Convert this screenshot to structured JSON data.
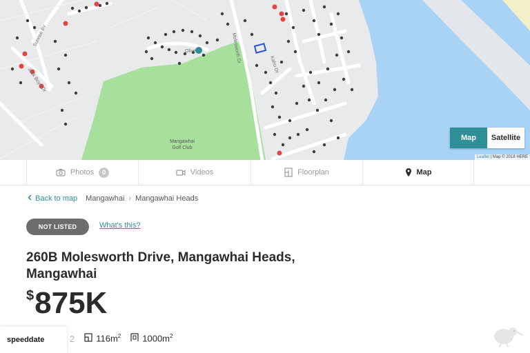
{
  "map": {
    "toggle": {
      "map_label": "Map",
      "satellite_label": "Satellite",
      "selected": "Map"
    },
    "labels": {
      "golf_line1": "Mangawhai",
      "golf_line2": "Golf Club"
    },
    "attribution": {
      "leaflet": "Leaflet",
      "rest": " | Map © 2018 HERE"
    },
    "colors": {
      "water": "#a9d3f5",
      "park": "#a7df9c",
      "land": "#e9eaec",
      "road": "#ffffff",
      "marker_red": "#e24444",
      "marker_teal": "#2e8f98",
      "house": "#3d3d3d",
      "sand": "#f4efc6"
    }
  },
  "tabs": [
    {
      "label": "Photos",
      "badge": "0",
      "icon": "camera-icon",
      "active": false
    },
    {
      "label": "Videos",
      "icon": "video-icon",
      "active": false
    },
    {
      "label": "Floorplan",
      "icon": "floorplan-icon",
      "active": false
    },
    {
      "label": "Map",
      "icon": "map-pin-icon",
      "active": true
    }
  ],
  "breadcrumb": {
    "back_label": "Back to map",
    "items": [
      "Mangawhai",
      "Mangawhai Heads"
    ]
  },
  "listing": {
    "status": "NOT LISTED",
    "whats_this": "What's this?",
    "address": "260B Molesworth Drive, Mangawhai Heads, Mangawhai",
    "price_currency": "$",
    "price_value": "875K",
    "features": {
      "bathrooms": "2",
      "floor_area": "116m",
      "land_area": "1000m",
      "area_unit_sup": "2"
    }
  },
  "widget": {
    "speeddate_label": "speeddate"
  },
  "brand": {
    "logo_icon": "kiwi-bird-icon"
  }
}
